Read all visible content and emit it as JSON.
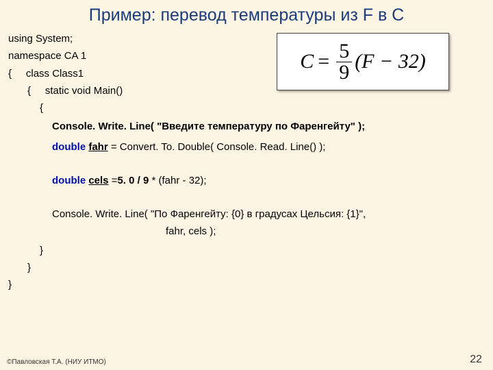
{
  "title": "Пример: перевод температуры из F в C",
  "formula": {
    "lhs": "C",
    "eq": "=",
    "num": "5",
    "den": "9",
    "rhs": "(F − 32)"
  },
  "code": {
    "l1": "using System;",
    "l2": "namespace CA 1",
    "l3_a": "{",
    "l3_b": "class Class1",
    "l4_a": "{",
    "l4_b": "static void Main()",
    "l5": "{",
    "l6_a": "Console. Write. Line( ",
    "l6_b": "\"Введите температуру по Фаренгейту\"",
    "l6_c": " );",
    "l7_kw": "double ",
    "l7_var": "fahr",
    "l7_rest": " = Convert. To. Double( Console. Read. Line() );",
    "l8_kw": "double ",
    "l8_var": "cels",
    "l8_eq": " =",
    "l8_expr1": "5. 0 / 9 ",
    "l8_expr2": "* (fahr - 32);",
    "l9": "Console. Write. Line( \"По Фаренгейту: {0} в градусах Цельсия: {1}\",",
    "l10": "fahr, cels );",
    "l11": "}",
    "l12": "}",
    "l13": "}"
  },
  "footer": "©Павловская Т.А. (НИУ ИТМО)",
  "page": "22"
}
